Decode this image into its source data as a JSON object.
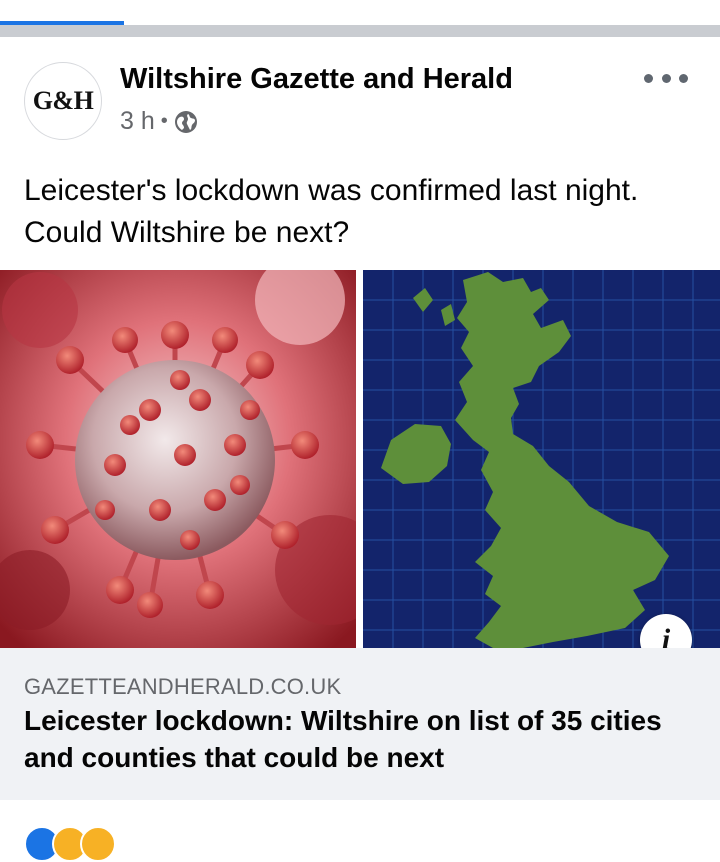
{
  "post": {
    "page_name": "Wiltshire Gazette and Herald",
    "avatar_text": "G&H",
    "time": "3 h",
    "separator": "•",
    "privacy_icon": "globe-icon",
    "more_icon": "more-dots-icon",
    "text_line1": "Leicester's lockdown was confirmed last night.",
    "text_line2": "Could Wiltshire be next?"
  },
  "media": {
    "left_image": "coronavirus-particle",
    "right_image": "uk-map",
    "info_glyph": "i"
  },
  "link": {
    "domain": "GAZETTEANDHERALD.CO.UK",
    "title": "Leicester lockdown: Wiltshire on list of 35 cities and counties that could be next"
  },
  "reactions": {
    "icons": [
      "like-icon",
      "care-icon",
      "haha-icon"
    ]
  },
  "colors": {
    "accent": "#1b74e4",
    "map_land": "#5e8f3a",
    "map_sea": "#13246b",
    "virus": "#c8313b"
  }
}
